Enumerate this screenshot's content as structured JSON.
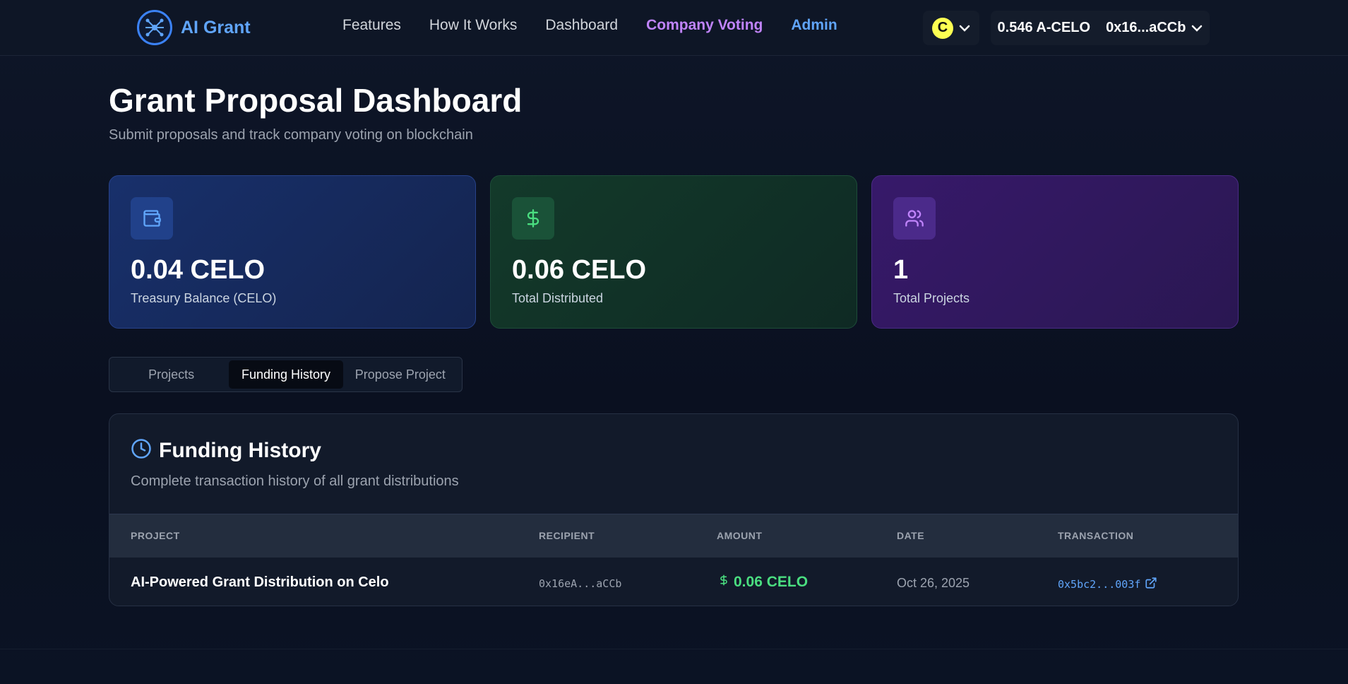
{
  "nav": {
    "brand": "AI Grant",
    "links": {
      "features": "Features",
      "how_it_works": "How It Works",
      "dashboard": "Dashboard",
      "company_voting": "Company Voting",
      "admin": "Admin"
    },
    "chain_symbol": "C",
    "wallet_balance": "0.546 A-CELO",
    "wallet_address": "0x16...aCCb"
  },
  "header": {
    "title": "Grant Proposal Dashboard",
    "subtitle": "Submit proposals and track company voting on blockchain"
  },
  "stats": [
    {
      "value": "0.04 CELO",
      "label": "Treasury Balance (CELO)",
      "icon": "wallet-icon",
      "color": "#60a5fa"
    },
    {
      "value": "0.06 CELO",
      "label": "Total Distributed",
      "icon": "dollar-icon",
      "color": "#4ade80"
    },
    {
      "value": "1",
      "label": "Total Projects",
      "icon": "users-icon",
      "color": "#c084fc"
    }
  ],
  "tabs": [
    "Projects",
    "Funding History",
    "Propose Project"
  ],
  "active_tab": "Funding History",
  "history": {
    "title": "Funding History",
    "subtitle": "Complete transaction history of all grant distributions",
    "columns": [
      "PROJECT",
      "RECIPIENT",
      "AMOUNT",
      "DATE",
      "TRANSACTION"
    ],
    "rows": [
      {
        "project": "AI-Powered Grant Distribution on Celo",
        "recipient": "0x16eA...aCCb",
        "amount": "0.06 CELO",
        "date": "Oct 26, 2025",
        "transaction": "0x5bc2...003f"
      }
    ]
  }
}
